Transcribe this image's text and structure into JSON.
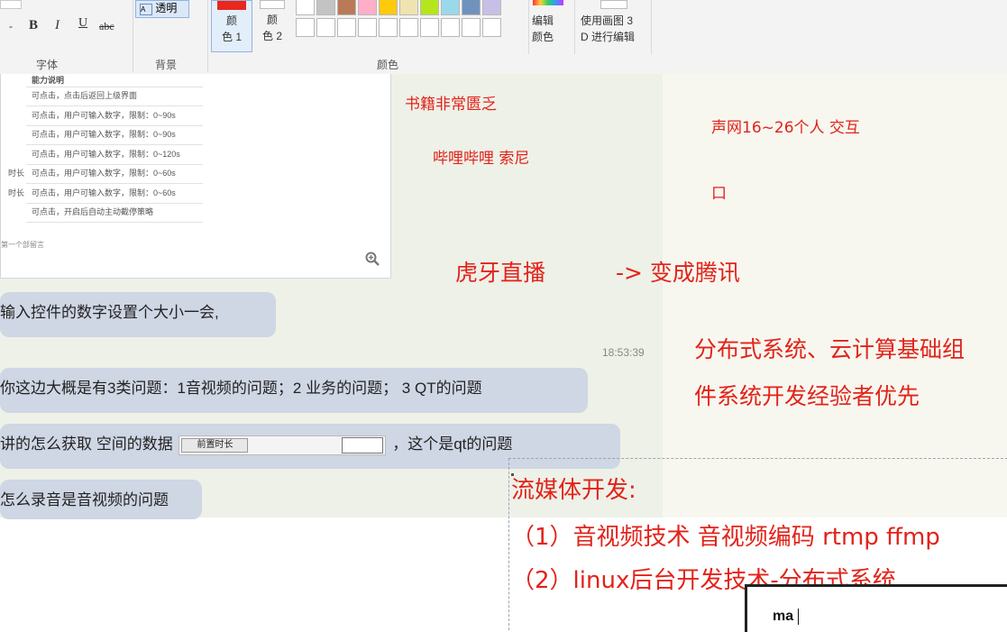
{
  "ribbon": {
    "font_size_arrow": "-",
    "bold": "B",
    "italic": "I",
    "underline": "U",
    "strike": "abc",
    "transparent": "透明",
    "color1": "颜\n色 1",
    "color2": "颜\n色 2",
    "edit_colors": "编辑\n颜色",
    "paint3d": "使用画图 3\nD 进行编辑",
    "groups": {
      "font": "字体",
      "background": "背景",
      "colors": "颜色"
    },
    "color1_hex": "#e8281e",
    "palette_row1": [
      "#ffffff",
      "#c3c3c3",
      "#b97a57",
      "#ffaec9",
      "#ffc90e",
      "#efe4b0",
      "#b5e61d",
      "#99d9ea",
      "#7092be",
      "#c8bfe7"
    ],
    "palette_row2": [
      "#ffffff",
      "#ffffff",
      "#ffffff",
      "#ffffff",
      "#ffffff",
      "#ffffff",
      "#ffffff",
      "#ffffff",
      "#ffffff",
      "#ffffff"
    ]
  },
  "doc": {
    "header": "能力说明",
    "rows": [
      {
        "left": "",
        "text": "可点击，点击后返回上级界面"
      },
      {
        "left": "",
        "text": "可点击，用户可输入数字，限制：0~90s"
      },
      {
        "left": "",
        "text": "可点击，用户可输入数字，限制：0~90s"
      },
      {
        "left": "",
        "text": "可点击，用户可输入数字，限制：0~120s"
      },
      {
        "left": "时长",
        "text": "可点击，用户可输入数字，限制：0~60s"
      },
      {
        "left": "时长",
        "text": "可点击，用户可输入数字，限制：0~60s"
      },
      {
        "left": "",
        "text": "可点击，开启后自动主动截停策略"
      }
    ],
    "footer": "第一个部留言",
    "zoom_icon": "zoom-in-icon"
  },
  "chat": {
    "messages": [
      "输入控件的数字设置个大小一会,",
      "你这边大概是有3类问题：1音视频的问题；2 业务的问题； 3 QT的问题",
      "讲的怎么获取 空间的数据",
      "，这个是qt的问题",
      "怎么录音是音视频的问题"
    ],
    "timestamp": "18:53:39",
    "inline_widget_label": "前置时长"
  },
  "notes": {
    "books": "书籍非常匮乏",
    "bilibili": "哔哩哔哩  索尼",
    "shengwang": "声网16~26个人 交互",
    "kou": "口",
    "huya": "虎牙直播",
    "tencent": "-> 变成腾讯",
    "distributed1": "分布式系统、云计算基础组",
    "distributed2": "件系统开发经验者优先",
    "stream_title": "流媒体开发:",
    "item1": "（1）音视频技术 音视频编码 rtmp ffmp",
    "item2": "（2）linux后台开发技术-分布式系统",
    "popup_text": "ma"
  }
}
